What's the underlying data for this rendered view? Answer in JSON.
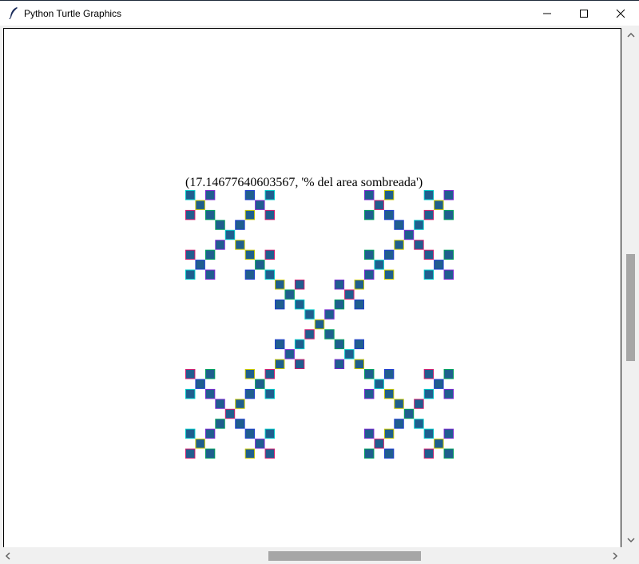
{
  "window": {
    "title": "Python Turtle Graphics",
    "icons": {
      "app": "feather-icon",
      "minimize": "minimize-icon",
      "maximize": "maximize-icon",
      "close": "close-icon"
    }
  },
  "canvas": {
    "output_text": "(17.14677640603567, '% del area sombreada')",
    "square_fill": "#1f5e8e",
    "outline_colors": [
      "#00c8c8",
      "#7a2ad0",
      "#c8c800",
      "#d02070",
      "#00a060",
      "#2040d0"
    ]
  },
  "scrollbars": {
    "vertical": {
      "up": "chevron-up-icon",
      "down": "chevron-down-icon"
    },
    "horizontal": {
      "left": "chevron-left-icon",
      "right": "chevron-right-icon"
    }
  }
}
